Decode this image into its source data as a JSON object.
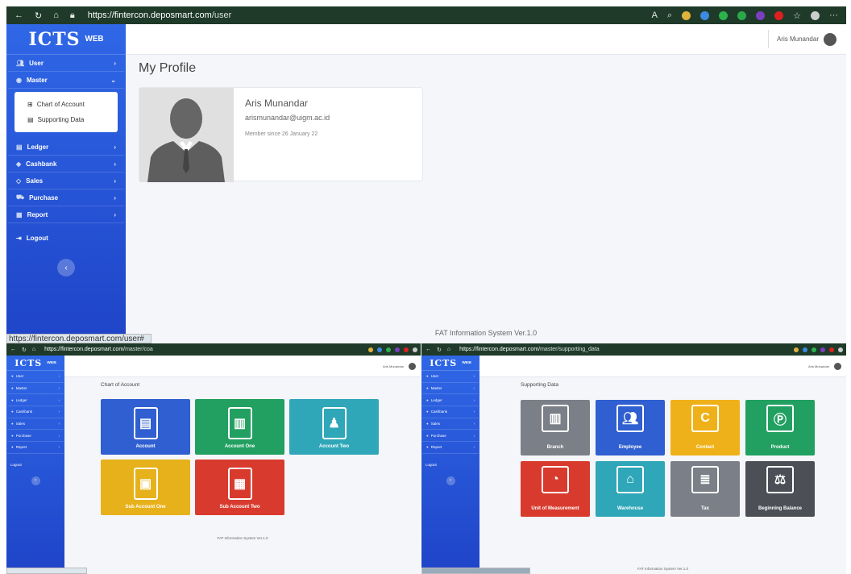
{
  "screens": {
    "profile": {
      "url": {
        "host": "https://fintercon.deposmart.com",
        "path": "/user"
      },
      "brand": {
        "name": "ICTS",
        "tag": "WEB"
      },
      "menu": [
        {
          "label": "User",
          "icon": "users-icon"
        },
        {
          "label": "Master",
          "icon": "database-icon"
        },
        {
          "label": "Ledger",
          "icon": "book-icon"
        },
        {
          "label": "Cashbank",
          "icon": "money-icon"
        },
        {
          "label": "Sales",
          "icon": "tag-icon"
        },
        {
          "label": "Purchase",
          "icon": "cart-icon"
        },
        {
          "label": "Report",
          "icon": "report-icon"
        }
      ],
      "submenu": [
        {
          "label": "Chart of Account",
          "icon": "sitemap-icon"
        },
        {
          "label": "Supporting Data",
          "icon": "database-icon"
        }
      ],
      "logout": "Logout",
      "topbar_user": "Aris Munandar",
      "page_title": "My Profile",
      "profile": {
        "name": "Aris Munandar",
        "email": "arismunandar@uigm.ac.id",
        "since": "Member since 26 January 22"
      },
      "footer": "FAT Information System Ver.1.0",
      "status_url": "https://fintercon.deposmart.com/user#"
    },
    "chart_of_account": {
      "url": {
        "host": "https://fintercon.deposmart.com",
        "path": "/master/coa"
      },
      "brand": {
        "name": "ICTS",
        "tag": "WEB"
      },
      "menu": [
        "User",
        "Master",
        "Ledger",
        "Cashbank",
        "Sales",
        "Purchase",
        "Report"
      ],
      "logout": "Logout",
      "topbar_user": "Aris Munandar",
      "page_title": "Chart of Account",
      "tiles": [
        {
          "label": "Account",
          "color": "#2f5fd0",
          "icon": "book-icon"
        },
        {
          "label": "Account One",
          "color": "#22a061",
          "icon": "open-book-icon"
        },
        {
          "label": "Account Two",
          "color": "#2fa7b8",
          "icon": "reader-icon"
        },
        {
          "label": "Sub Account One",
          "color": "#e6b11a",
          "icon": "address-book-icon"
        },
        {
          "label": "Sub Account Two",
          "color": "#d83b2e",
          "icon": "id-card-icon"
        }
      ],
      "footer": "FAT Information System Ver.1.0"
    },
    "supporting_data": {
      "url": {
        "host": "https://fintercon.deposmart.com",
        "path": "/master/supporting_data"
      },
      "brand": {
        "name": "ICTS",
        "tag": "WEB"
      },
      "menu": [
        "User",
        "Master",
        "Ledger",
        "Cashbank",
        "Sales",
        "Purchase",
        "Report"
      ],
      "logout": "Logout",
      "topbar_user": "Aris Munandar",
      "page_title": "Supporting Data",
      "tiles": [
        {
          "label": "Branch",
          "color": "#7b7f87",
          "icon": "building-icon"
        },
        {
          "label": "Employee",
          "color": "#2f5fd0",
          "icon": "users-icon"
        },
        {
          "label": "Contact",
          "color": "#efb11a",
          "icon": "contact-icon"
        },
        {
          "label": "Product",
          "color": "#22a061",
          "icon": "product-icon"
        },
        {
          "label": "Unit of Measurement",
          "color": "#d83b2e",
          "icon": "scale-gauge-icon"
        },
        {
          "label": "Warehouse",
          "color": "#2fa7b8",
          "icon": "warehouse-icon"
        },
        {
          "label": "Tax",
          "color": "#7b7f87",
          "icon": "receipt-icon"
        },
        {
          "label": "Beginning Balance",
          "color": "#4d4f57",
          "icon": "balance-scale-icon"
        }
      ],
      "footer": "FAT Information System Ver.1.0"
    }
  }
}
